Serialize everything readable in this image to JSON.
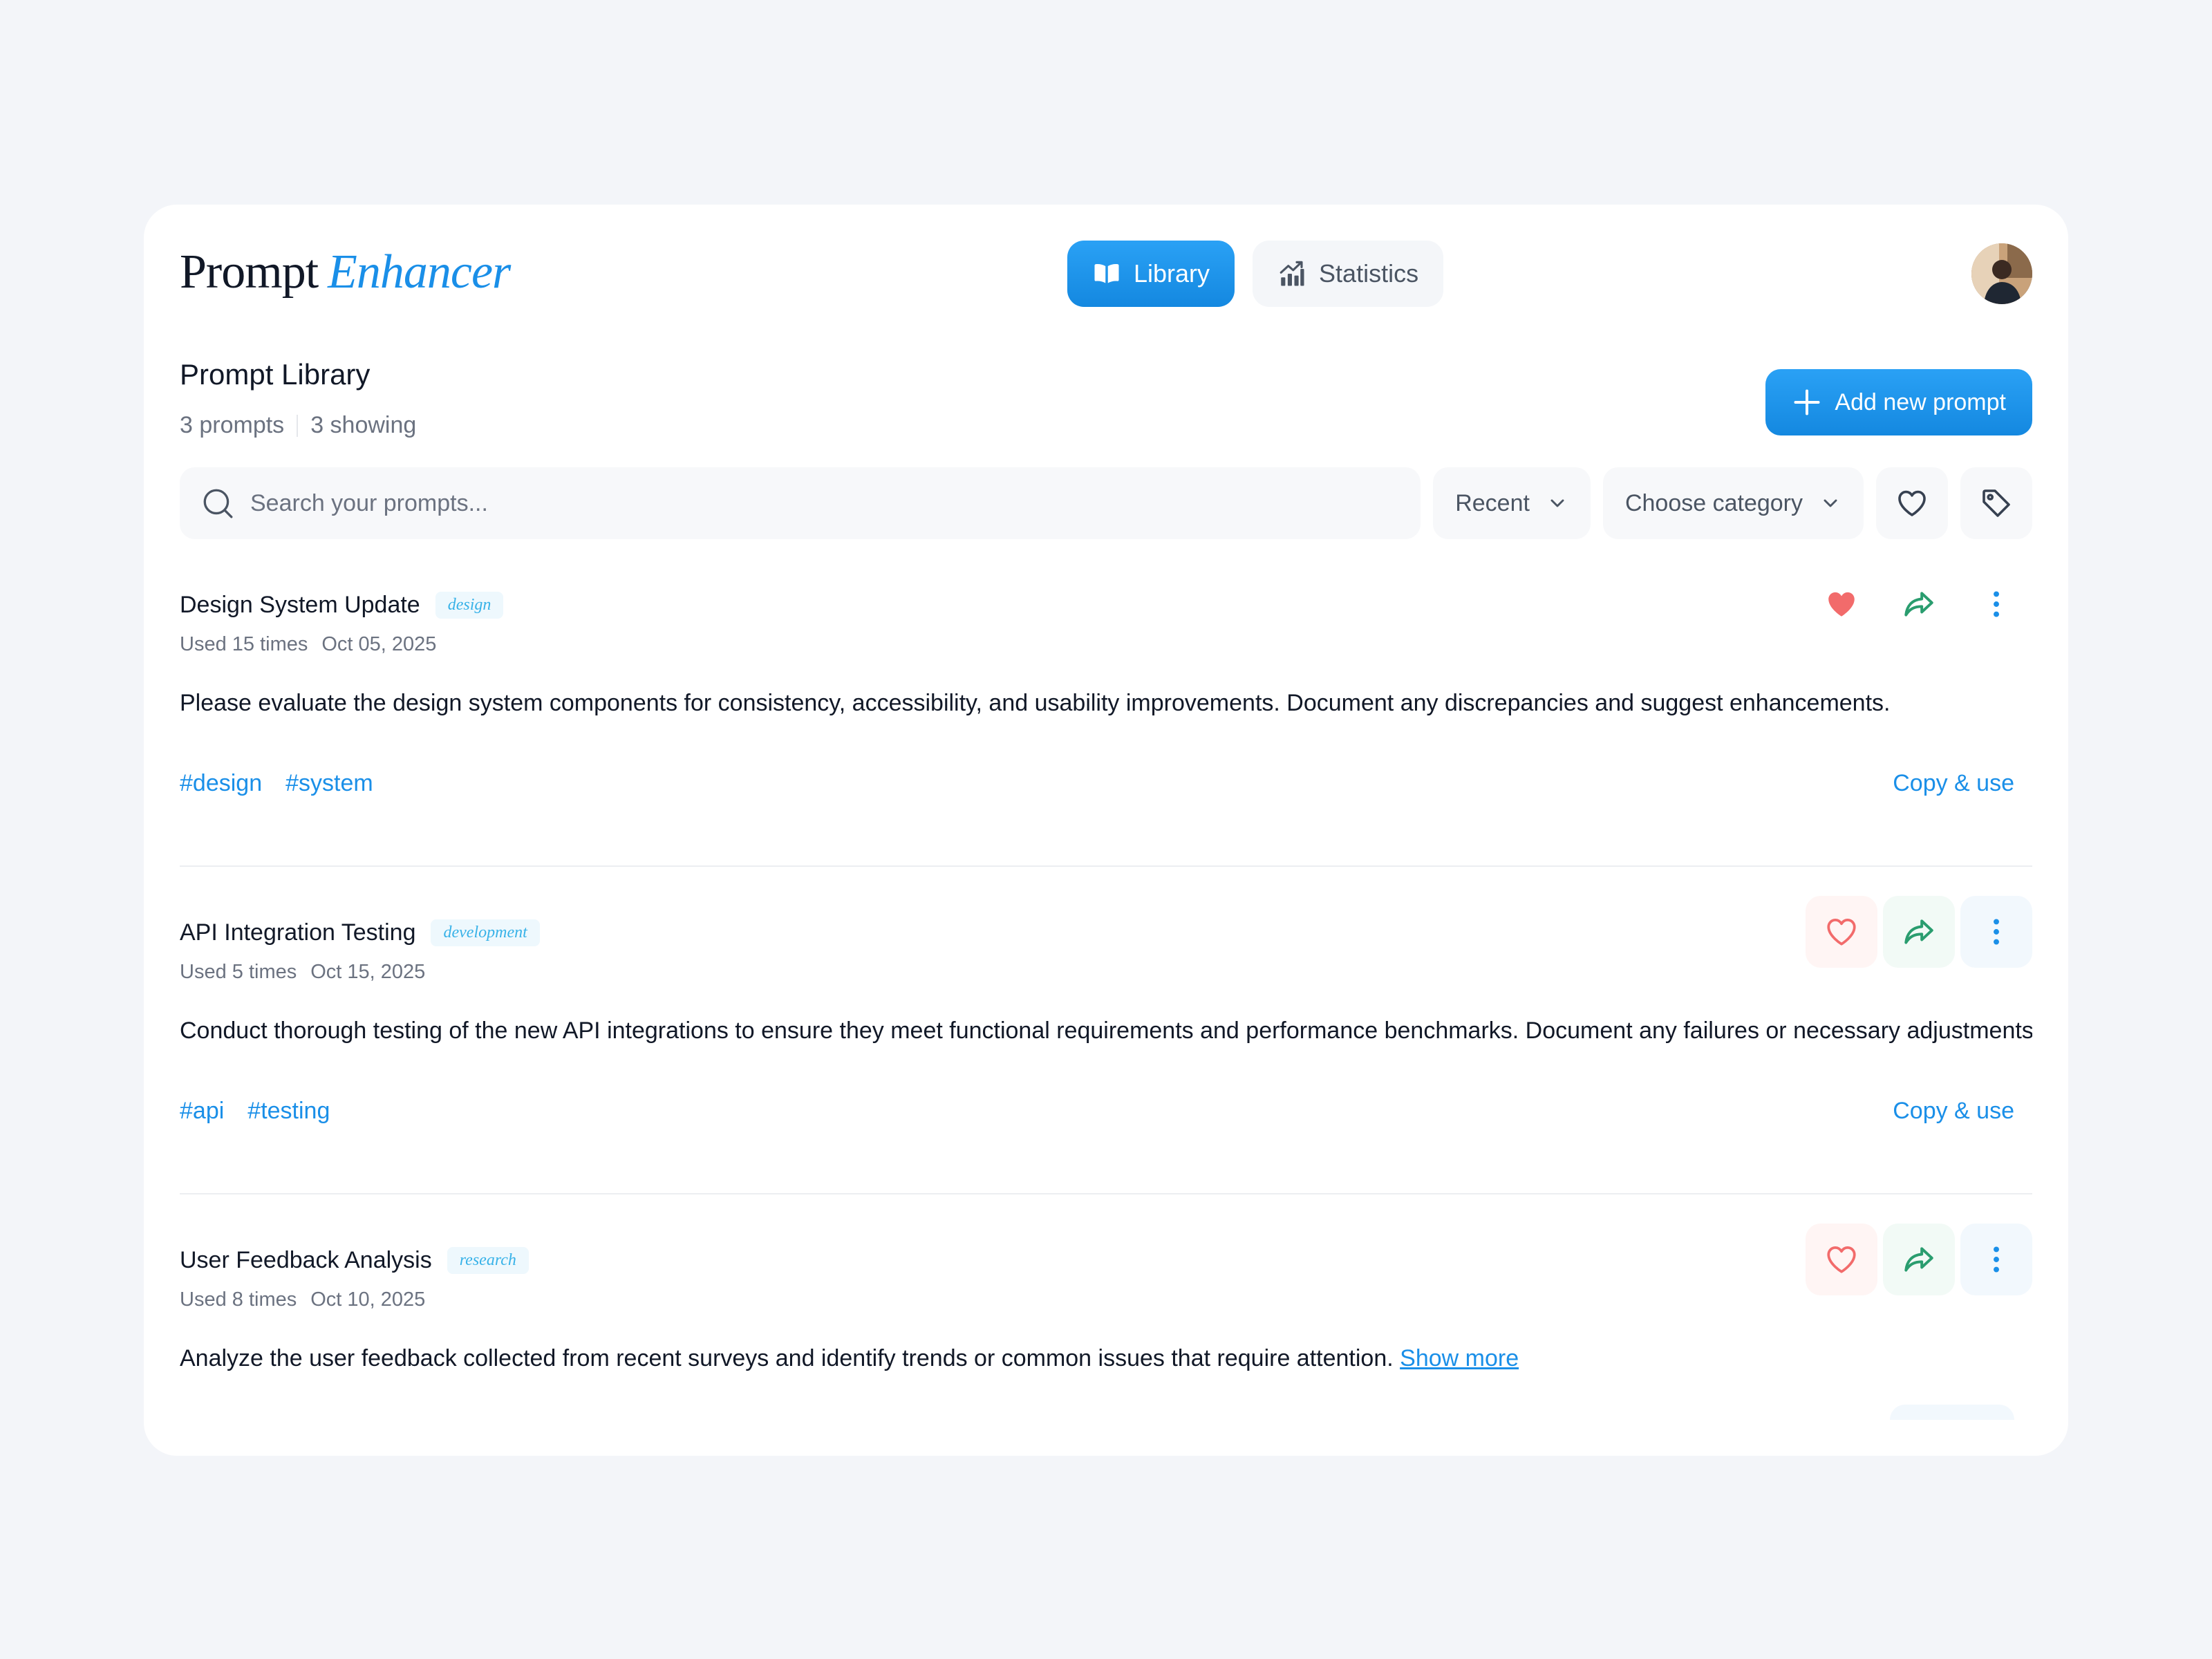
{
  "app": {
    "logo_part1": "Prompt",
    "logo_part2": "Enhancer",
    "accent_color": "#1a8fe8"
  },
  "nav": {
    "tabs": [
      {
        "label": "Library",
        "icon": "book-icon",
        "active": true
      },
      {
        "label": "Statistics",
        "icon": "bar-chart-icon",
        "active": false
      }
    ]
  },
  "library": {
    "title": "Prompt Library",
    "count_total": "3 prompts",
    "count_showing": "3 showing",
    "add_button": "Add new prompt"
  },
  "toolbar": {
    "search_placeholder": "Search your prompts...",
    "sort_value": "Recent",
    "category_value": "Choose category"
  },
  "prompts": [
    {
      "title": "Design System Update",
      "category": "design",
      "usage": "Used 15 times",
      "date": "Oct 05, 2025",
      "description": "Please evaluate the design system components for consistency, accessibility, and usability improvements. Document any discrepancies and suggest enhancements.",
      "tags": [
        "#design",
        "#system"
      ],
      "favorited": true,
      "copy_label": "Copy & use"
    },
    {
      "title": "API Integration Testing",
      "category": "development",
      "usage": "Used 5 times",
      "date": "Oct 15, 2025",
      "description": "Conduct thorough testing of the new API integrations to ensure they meet functional requirements and performance benchmarks. Document any failures or necessary adjustments.",
      "tags": [
        "#api",
        "#testing"
      ],
      "favorited": false,
      "copy_label": "Copy & use"
    },
    {
      "title": "User Feedback Analysis",
      "category": "research",
      "usage": "Used 8 times",
      "date": "Oct 10, 2025",
      "description": "Analyze the user feedback collected from recent surveys and identify trends or common issues that require attention.",
      "show_more": "Show more",
      "favorited": false
    }
  ]
}
